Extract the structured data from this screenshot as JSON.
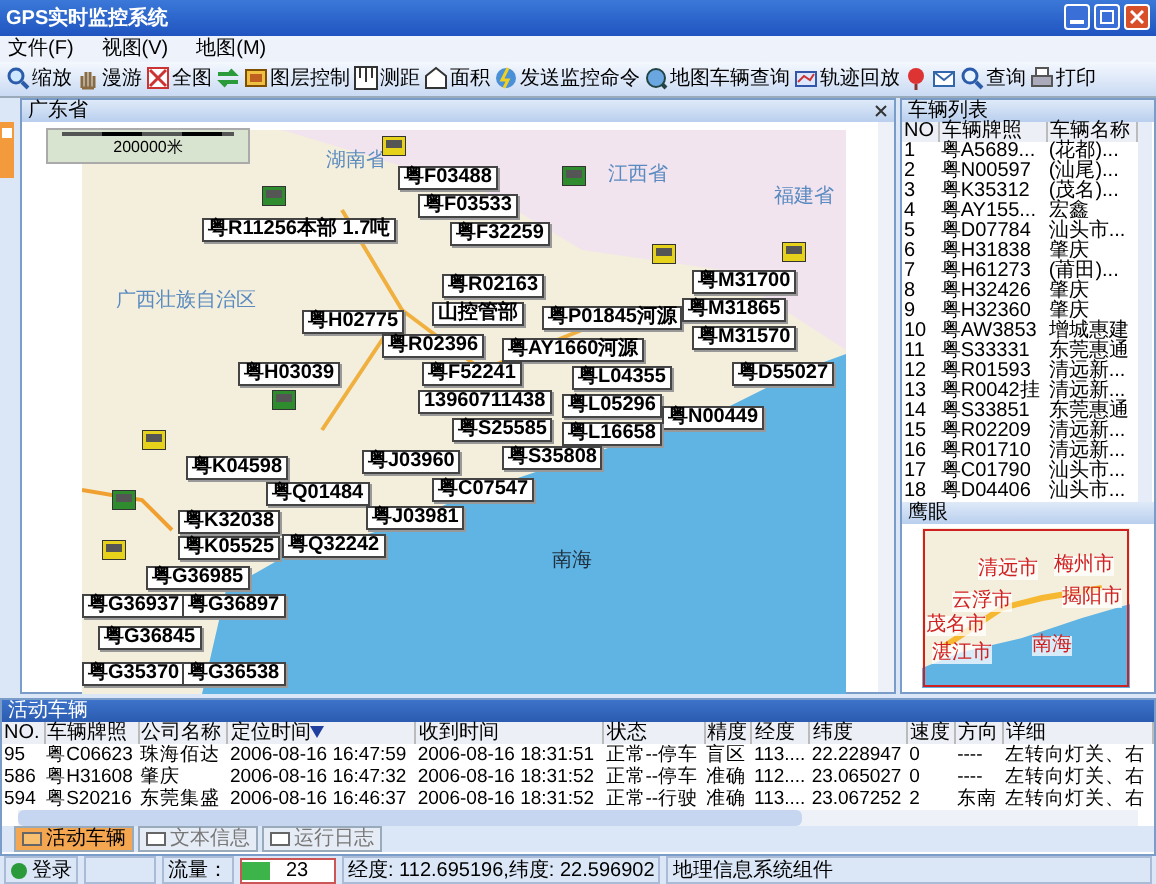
{
  "window": {
    "title": "GPS实时监控系统"
  },
  "menu": [
    "文件(F)",
    "视图(V)",
    "地图(M)"
  ],
  "toolbar": [
    {
      "label": "缩放",
      "kind": "zoom"
    },
    {
      "label": "漫游",
      "kind": "pan"
    },
    {
      "label": "全图",
      "kind": "full"
    },
    {
      "kind": "refresh"
    },
    {
      "label": "图层控制",
      "kind": "layers"
    },
    {
      "label": "测距",
      "kind": "ruler"
    },
    {
      "label": "面积",
      "kind": "area"
    },
    {
      "label": "发送监控命令",
      "kind": "send"
    },
    {
      "label": "地图车辆查询",
      "kind": "mapsearch"
    },
    {
      "label": "轨迹回放",
      "kind": "track"
    },
    {
      "kind": "pin"
    },
    {
      "kind": "mail"
    },
    {
      "label": "查询",
      "kind": "search"
    },
    {
      "label": "打印",
      "kind": "print"
    }
  ],
  "map": {
    "title": "广东省",
    "scale": "200000米",
    "regions": [
      {
        "name": "湖南省",
        "kind": "province"
      },
      {
        "name": "江西省",
        "kind": "province"
      },
      {
        "name": "福建省",
        "kind": "province"
      },
      {
        "name": "广西壮族自治区",
        "kind": "province"
      },
      {
        "name": "南海",
        "kind": "sea"
      }
    ],
    "vehicles": [
      "粤F03488",
      "粤F03533",
      "粤F32259",
      "粤R11256本部 1.7吨",
      "粤M31700",
      "粤R02163",
      "粤H02775",
      "山控管部",
      "粤P01845河源",
      "粤M31865",
      "粤M31570",
      "粤R02396",
      "粤AY1660河源",
      "粤H03039",
      "粤F52241",
      "粤L04355",
      "粤D55027",
      "13960711438",
      "粤L05296",
      "粤N00449",
      "粤S25585",
      "粤L16658",
      "粤J03960",
      "粤S35808",
      "粤K04598",
      "粤C07547",
      "粤Q01484",
      "粤J03981",
      "粤K32038",
      "粤Q32242",
      "粤K05525",
      "粤G36985",
      "粤G36937",
      "粤G36897",
      "粤G36845",
      "粤G35370",
      "粤G36538"
    ],
    "trucks": [
      {
        "color": "#e6d21a"
      },
      {
        "color": "#2e8b2e"
      },
      {
        "color": "#e6d21a"
      },
      {
        "color": "#e6d21a"
      },
      {
        "color": "#2e8b2e"
      },
      {
        "color": "#2e8b2e"
      },
      {
        "color": "#e6d21a"
      },
      {
        "color": "#e6d21a"
      },
      {
        "color": "#2e8b2e"
      }
    ]
  },
  "vehicle_list": {
    "title": "车辆列表",
    "columns": [
      "NO",
      "车辆牌照",
      "车辆名称"
    ],
    "rows": [
      [
        "1",
        "粤A5689...",
        "(花都)..."
      ],
      [
        "2",
        "粤N00597",
        "(汕尾)..."
      ],
      [
        "3",
        "粤K35312",
        "(茂名)..."
      ],
      [
        "4",
        "粤AY155...",
        "宏鑫"
      ],
      [
        "5",
        "粤D07784",
        "汕头市..."
      ],
      [
        "6",
        "粤H31838",
        "肇庆"
      ],
      [
        "7",
        "粤H61273",
        "(莆田)..."
      ],
      [
        "8",
        "粤H32426",
        "肇庆"
      ],
      [
        "9",
        "粤H32360",
        "肇庆"
      ],
      [
        "10",
        "粤AW3853",
        "增城惠建"
      ],
      [
        "11",
        "粤S33331",
        "东莞惠通"
      ],
      [
        "12",
        "粤R01593",
        "清远新..."
      ],
      [
        "13",
        "粤R0042挂",
        "清远新..."
      ],
      [
        "14",
        "粤S33851",
        "东莞惠通"
      ],
      [
        "15",
        "粤R02209",
        "清远新..."
      ],
      [
        "16",
        "粤R01710",
        "清远新..."
      ],
      [
        "17",
        "粤C01790",
        "汕头市..."
      ],
      [
        "18",
        "粤D04406",
        "汕头市..."
      ]
    ]
  },
  "overview": {
    "title": "鹰眼",
    "labels": [
      "清远市",
      "梅州市",
      "云浮市",
      "揭阳市",
      "茂名市",
      "湛江市",
      "南海"
    ]
  },
  "active_vehicles": {
    "title": "活动车辆",
    "columns": [
      {
        "label": "NO.",
        "sorted": false
      },
      {
        "label": "车辆牌照",
        "sorted": false
      },
      {
        "label": "公司名称",
        "sorted": false
      },
      {
        "label": "定位时间",
        "sorted": true
      },
      {
        "label": "收到时间",
        "sorted": false
      },
      {
        "label": "状态",
        "sorted": false
      },
      {
        "label": "精度",
        "sorted": false
      },
      {
        "label": "经度",
        "sorted": false
      },
      {
        "label": "纬度",
        "sorted": false
      },
      {
        "label": "速度",
        "sorted": false
      },
      {
        "label": "方向",
        "sorted": false
      },
      {
        "label": "详细",
        "sorted": false
      }
    ],
    "rows": [
      [
        "95",
        "粤C06623",
        "珠海佰达",
        "2006-08-16 16:47:59",
        "2006-08-16 18:31:51",
        "正常--停车",
        "盲区",
        "113....",
        "22.228947",
        "0",
        "----",
        "左转向灯关、右"
      ],
      [
        "586",
        "粤H31608",
        "肇庆",
        "2006-08-16 16:47:32",
        "2006-08-16 18:31:52",
        "正常--停车",
        "准确",
        "112....",
        "23.065027",
        "0",
        "----",
        "左转向灯关、右"
      ],
      [
        "594",
        "粤S20216",
        "东莞集盛",
        "2006-08-16 16:46:37",
        "2006-08-16 18:31:52",
        "正常--行驶",
        "准确",
        "113....",
        "23.067252",
        "2",
        "东南",
        "左转向灯关、右"
      ]
    ]
  },
  "bottom_tabs": [
    {
      "label": "活动车辆",
      "selected": true
    },
    {
      "label": "文本信息",
      "selected": false
    },
    {
      "label": "运行日志",
      "selected": false
    }
  ],
  "status_bar": {
    "login": "登录",
    "flow_label": "流量：",
    "flow_value": "23",
    "level": 0.3,
    "coords": "经度: 112.695196,纬度: 22.596902",
    "component": "地理信息系统组件"
  }
}
